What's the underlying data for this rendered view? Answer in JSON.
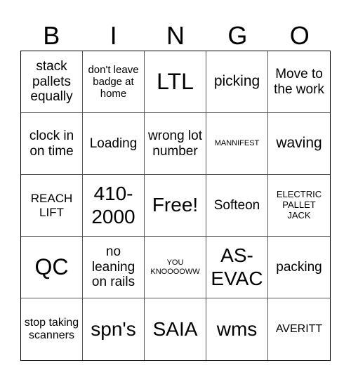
{
  "header": {
    "letters": [
      "B",
      "I",
      "N",
      "G",
      "O"
    ]
  },
  "board": {
    "rows": [
      [
        "stack pallets equally",
        "don't leave badge at home",
        "LTL",
        "picking",
        "Move to the work"
      ],
      [
        "clock in on time",
        "Loading",
        "wrong lot number",
        "MANNIFEST",
        "waving"
      ],
      [
        "REACH LIFT",
        "410-2000",
        "Free!",
        "Softeon",
        "ELECTRIC PALLET JACK"
      ],
      [
        "QC",
        "no leaning on rails",
        "YOU KNOOOOWW",
        "AS-EVAC",
        "packing"
      ],
      [
        "stop taking scanners",
        "spn's",
        "SAIA",
        "wms",
        "AVERITT"
      ]
    ]
  }
}
